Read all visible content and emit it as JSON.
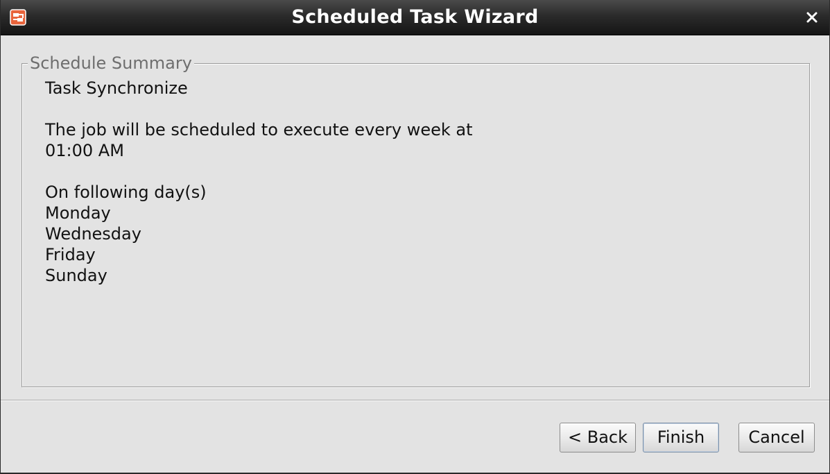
{
  "window": {
    "title": "Scheduled Task Wizard",
    "app_icon": "scheduler-app-icon",
    "close_icon": "close-icon"
  },
  "group": {
    "legend": "Schedule Summary",
    "lines": [
      "Task Synchronize",
      "",
      "The job will be scheduled to execute every week at",
      "01:00 AM",
      "",
      "On following day(s)",
      "Monday",
      "Wednesday",
      "Friday",
      "Sunday"
    ]
  },
  "buttons": {
    "back": "< Back",
    "finish": "Finish",
    "cancel": "Cancel"
  },
  "colors": {
    "titlebar": "#2b2b2b",
    "background": "#e3e3e3",
    "accent_icon": "#e8643c"
  }
}
